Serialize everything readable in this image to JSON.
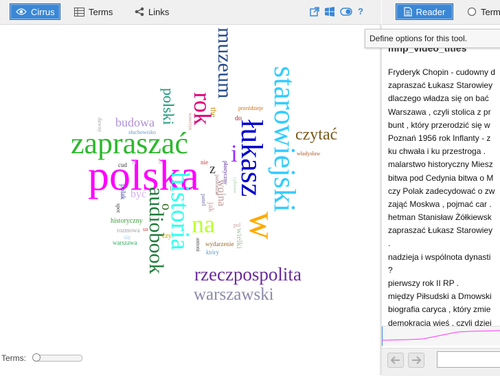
{
  "toolbar": {
    "tabs": [
      {
        "label": "Cirrus",
        "icon": "eye-icon",
        "active": true
      },
      {
        "label": "Terms",
        "icon": "table-icon",
        "active": false
      },
      {
        "label": "Links",
        "icon": "share-icon",
        "active": false
      }
    ],
    "tool_icons": [
      "export-icon",
      "windows-icon",
      "toggle-icon",
      "help-icon"
    ]
  },
  "right_toolbar": {
    "reader_label": "Reader",
    "terms_label": "Terms"
  },
  "tooltip": "Define options for this tool.",
  "terms_slider": {
    "label": "Terms:",
    "value": 0
  },
  "reader": {
    "title": "mnp_video_titles",
    "lines": [
      "Fryderyk Chopin - cudowny d",
      "zapraszać Łukasz Starowiey",
      "dlaczego władza się on bać",
      "Warszawa , czyli stolica z pr",
      "bunt , który przerodzić się w",
      "Poznań 1956 rok Inflanty - z",
      "ku chwała i ku przestroga .",
      "malarstwo historyczny Miesz",
      "bitwa pod Cedynia bitwa o M",
      "czy Polak zadecydować o zw",
      "zająć Moskwa , pojmać car .",
      "hetman Stanisław Żółkiewsk",
      "zapraszać Łukasz Starowiey",
      ".",
      "nadzieja i wspólnota dynasti",
      "?",
      "pierwszy rok II RP .",
      "między Piłsudski a Dmowski",
      "biografia caryca , który zmie",
      "demokracja wieś , czyli dziej"
    ]
  },
  "cloud_words": [
    {
      "text": "polska",
      "color": "#ff00ff"
    },
    {
      "text": "zapraszać",
      "color": "#2eb82e"
    },
    {
      "text": "starowiejski",
      "color": "#33ccff"
    },
    {
      "text": "łukasz",
      "color": "#0000cc"
    },
    {
      "text": "muzeum",
      "color": "#2a4e8f"
    },
    {
      "text": "historia",
      "color": "#33ffee"
    },
    {
      "text": "audiobook",
      "color": "#1f7a3a"
    },
    {
      "text": "rok",
      "color": "#e0007a"
    },
    {
      "text": "w",
      "color": "#ffaa00"
    },
    {
      "text": "rzeczpospolita",
      "color": "#6a2a9a"
    },
    {
      "text": "warszawski",
      "color": "#8a8aaa"
    },
    {
      "text": "czytać",
      "color": "#7a5a1a"
    },
    {
      "text": "i",
      "color": "#9933ff"
    },
    {
      "text": "na",
      "color": "#bbff33"
    },
    {
      "text": "polski",
      "color": "#1a9a7a"
    },
    {
      "text": "budowa",
      "color": "#b08fd8"
    },
    {
      "text": "o",
      "color": "#2a6a1a"
    },
    {
      "text": "wojna",
      "color": "#c09a9a"
    },
    {
      "text": "z",
      "color": "#333333"
    },
    {
      "text": "wielki",
      "color": "#a0c0a0"
    },
    {
      "text": "czy",
      "color": "#c0a000"
    },
    {
      "text": "być",
      "color": "#d0b0f0"
    },
    {
      "text": "historyczny",
      "color": "#3a9a3a"
    },
    {
      "text": "polak",
      "color": "#3a3aaa"
    },
    {
      "text": "rozmowa",
      "color": "#a0a0a0"
    },
    {
      "text": "warszawa",
      "color": "#2aaa5a"
    },
    {
      "text": "się",
      "color": "#aaccee"
    },
    {
      "text": "słuchowisko",
      "color": "#6a9aca"
    },
    {
      "text": "do",
      "color": "#aa2a2a"
    },
    {
      "text": "władysław",
      "color": "#aa5a2a"
    },
    {
      "text": "wydarzenie",
      "color": "#9a6a2a"
    },
    {
      "text": "który",
      "color": "#5a9aca"
    },
    {
      "text": "nie",
      "color": "#cc3a3a"
    },
    {
      "text": "jak",
      "color": "#d0a0a0"
    },
    {
      "text": "antoni",
      "color": "#4a4a4a"
    },
    {
      "text": "the",
      "color": "#cc8800"
    },
    {
      "text": "płastyczny",
      "color": "#5a2a9a"
    },
    {
      "text": "przeździeje",
      "color": "#cc6a00"
    },
    {
      "text": "cud",
      "color": "#3a3a3a"
    },
    {
      "text": "panel",
      "color": "#6a6aaa"
    },
    {
      "text": "spot",
      "color": "#3a3a3a"
    },
    {
      "text": "dawny",
      "color": "#aaaaaa"
    },
    {
      "text": "wawrzyn",
      "color": "#cc8888"
    },
    {
      "text": "pasłodzie",
      "color": "#aa8888"
    },
    {
      "text": "cyfrowe",
      "color": "#aaccaa"
    },
    {
      "text": "25",
      "color": "#aaaaaa"
    },
    {
      "text": "1",
      "color": "#888888"
    },
    {
      "text": "pol",
      "color": "#cc9999"
    },
    {
      "text": "ii",
      "color": "#aaccee"
    },
    {
      "text": "ua",
      "color": "#cc4444"
    }
  ]
}
